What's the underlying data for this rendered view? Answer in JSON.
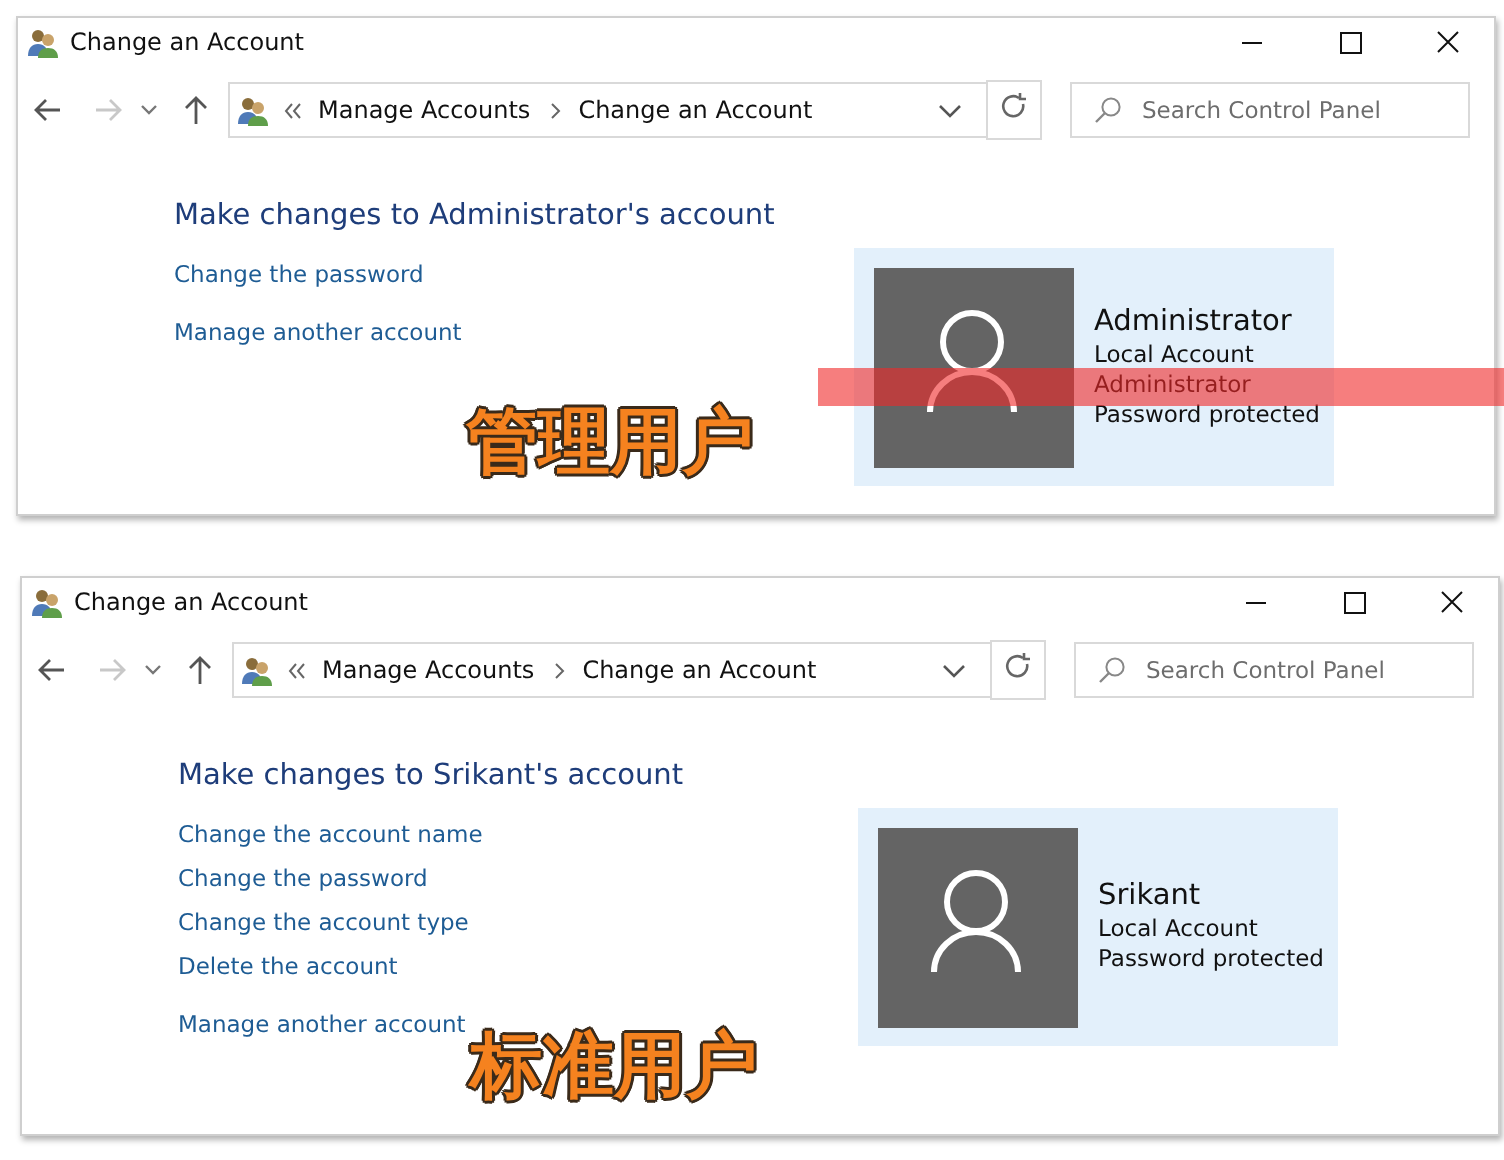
{
  "windows": [
    {
      "title": "Change an Account",
      "breadcrumb": [
        "Manage Accounts",
        "Change an Account"
      ],
      "search": {
        "placeholder": "Search Control Panel"
      },
      "heading": "Make changes to Administrator's account",
      "actions": [
        "Change the password"
      ],
      "other_link": "Manage another account",
      "account": {
        "name": "Administrator",
        "details": [
          "Local Account",
          "Administrator",
          "Password protected"
        ]
      },
      "annotation": {
        "caption": "管理用户",
        "highlight": true
      }
    },
    {
      "title": "Change an Account",
      "breadcrumb": [
        "Manage Accounts",
        "Change an Account"
      ],
      "search": {
        "placeholder": "Search Control Panel"
      },
      "heading": "Make changes to Srikant's account",
      "actions": [
        "Change the account name",
        "Change the password",
        "Change the account type",
        "Delete the account"
      ],
      "other_link": "Manage another account",
      "account": {
        "name": "Srikant",
        "details": [
          "Local Account",
          "Password protected"
        ]
      },
      "annotation": {
        "caption": "标准用户",
        "highlight": false
      }
    }
  ]
}
